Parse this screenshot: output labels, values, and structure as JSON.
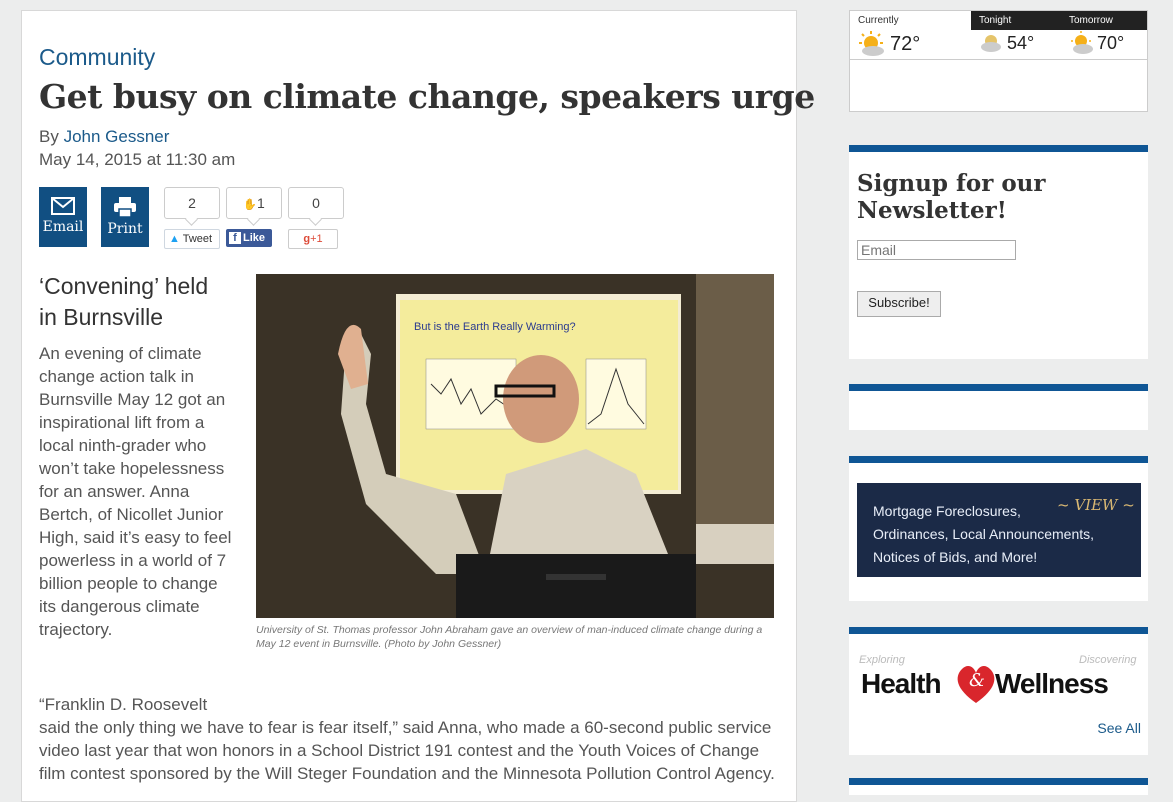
{
  "article": {
    "category": "Community",
    "headline": "Get busy on climate change, speakers urge",
    "byline_prefix": "By",
    "author": "John Gessner",
    "date": "May 14, 2015 at 11:30 am",
    "share": {
      "email_label": "Email",
      "print_label": "Print",
      "tweet_count": "2",
      "tweet_label": "Tweet",
      "fb_count": "1",
      "fb_label": "Like",
      "gplus_count": "0",
      "gplus_label": "+1"
    },
    "subhead": "‘Convening’ held in Burnsville",
    "lede": "An evening of climate change action talk in Burnsville May 12 got an inspirational lift from a local ninth-grader who won’t take hopelessness for an answer. Anna Bertch, of Nicollet Junior High, said it’s easy to feel powerless in a world of 7 billion people to change its dangerous climate trajectory.",
    "photo": {
      "slide_title": "But is the Earth Really Warming?"
    },
    "caption": "University of St. Thomas professor John Abraham gave an overview of man-induced climate change during a May 12 event in Burnsville. (Photo by John Gessner)",
    "body_first": "“Franklin D. Roosevelt",
    "body_rest": "said the only thing we have to fear is fear itself,” said Anna, who made a 60-second public service video last year that won honors in a School District 191 contest and the Youth Voices of Change film contest sponsored by the Will Steger Foundation and the Minnesota Pollution Control Agency."
  },
  "weather": {
    "currently_label": "Currently",
    "currently_temp": "72°",
    "tonight_label": "Tonight",
    "tonight_temp": "54°",
    "tomorrow_label": "Tomorrow",
    "tomorrow_temp": "70°"
  },
  "newsletter": {
    "title": "Signup for our Newsletter!",
    "email_placeholder": "Email",
    "subscribe_label": "Subscribe!"
  },
  "ad": {
    "text_line1": "Mortgage Foreclosures,",
    "text_line2": "Ordinances, Local Announcements,",
    "text_line3": "Notices of Bids, and More!",
    "view_label": "~ VIEW ~"
  },
  "health": {
    "logo_word1": "Health",
    "logo_amp": "&",
    "logo_word2": "Wellness",
    "small_left": "Exploring",
    "small_right": "Discovering",
    "see_all": "See All"
  },
  "colors": {
    "accent": "#114f82",
    "link": "#1b5a8a",
    "sidebar_border": "#0f5695"
  }
}
